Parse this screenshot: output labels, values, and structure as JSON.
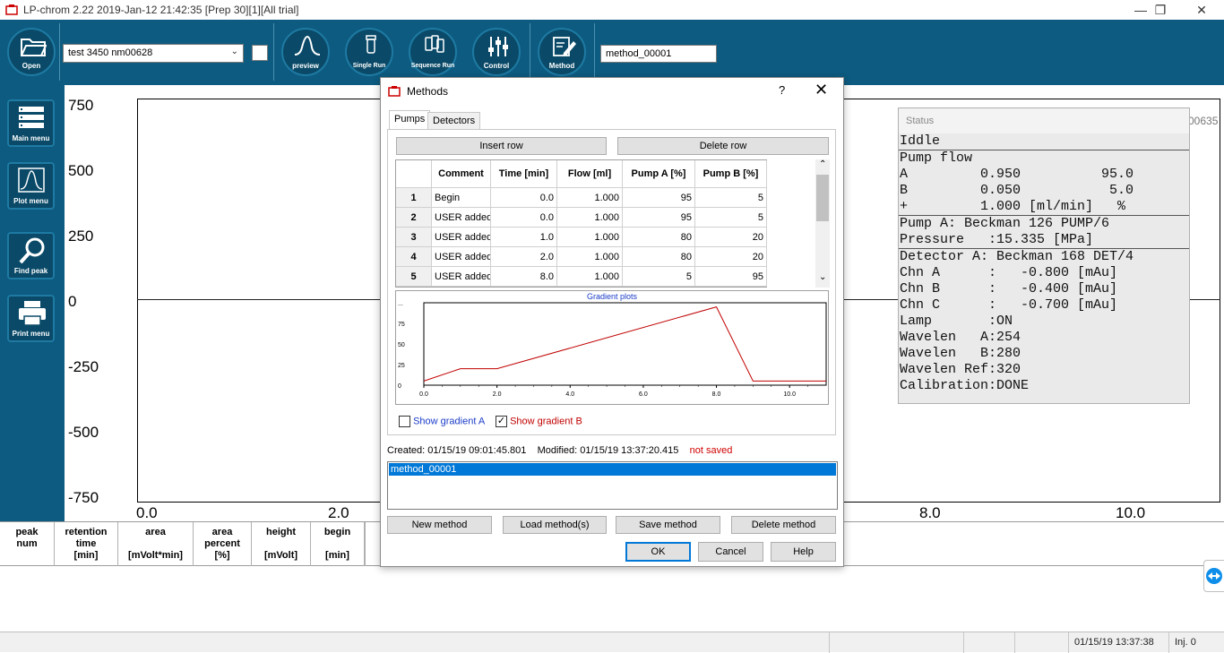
{
  "window": {
    "title": "LP-chrom 2.22 2019-Jan-12 21:42:35 [Prep 30][1][All trial]",
    "minimize": "—",
    "restore": "❐",
    "close": "✕"
  },
  "toolbar": {
    "open_label": "Open",
    "selected_sample": "test 3450 nm00628",
    "preview_label": "preview",
    "single_run_label": "Single Run",
    "sequence_run_label": "Sequence Run",
    "control_label": "Control",
    "method_label": "Method",
    "method_name": "method_00001"
  },
  "sidebar": {
    "items": [
      {
        "label": "Main menu",
        "icon": "list-icon"
      },
      {
        "label": "Plot menu",
        "icon": "peak-icon"
      },
      {
        "label": "Find peak",
        "icon": "magnifier-icon"
      },
      {
        "label": "Print menu",
        "icon": "printer-icon"
      }
    ]
  },
  "plot": {
    "y_ticks": [
      "750",
      "500",
      "250",
      "0",
      "-250",
      "-500",
      "-750"
    ],
    "x_ticks": [
      "0.0",
      "2.0",
      "8.0",
      "10.0"
    ],
    "corner_label": "00635"
  },
  "status_panel": {
    "header": "Status",
    "lines": [
      {
        "text": "Iddle",
        "sep": false
      },
      {
        "text": "Pump flow",
        "sep": true
      },
      {
        "text": "A         0.950          95.0",
        "sep": false
      },
      {
        "text": "B         0.050           5.0",
        "sep": false
      },
      {
        "text": "+         1.000 [ml/min]   %",
        "sep": false
      },
      {
        "text": "Pump A: Beckman 126 PUMP/6",
        "sep": true
      },
      {
        "text": "Pressure   :15.335 [MPa]",
        "sep": false
      },
      {
        "text": "Detector A: Beckman 168 DET/4",
        "sep": true
      },
      {
        "text": "Chn A      :   -0.800 [mAu]",
        "sep": false
      },
      {
        "text": "Chn B      :   -0.400 [mAu]",
        "sep": false
      },
      {
        "text": "Chn C      :   -0.700 [mAu]",
        "sep": false
      },
      {
        "text": "Lamp       :ON",
        "sep": false
      },
      {
        "text": "Wavelen   A:254",
        "sep": false
      },
      {
        "text": "Wavelen   B:280",
        "sep": false
      },
      {
        "text": "Wavelen Ref:320",
        "sep": false
      },
      {
        "text": "Calibration:DONE",
        "sep": false
      }
    ]
  },
  "peak_table": {
    "headers": [
      {
        "line1": "peak",
        "line2": "num",
        "line3": ""
      },
      {
        "line1": "retention",
        "line2": "time",
        "line3": "[min]"
      },
      {
        "line1": "area",
        "line2": "",
        "line3": "[mVolt*min]"
      },
      {
        "line1": "area",
        "line2": "percent",
        "line3": "[%]"
      },
      {
        "line1": "height",
        "line2": "",
        "line3": "[mVolt]"
      },
      {
        "line1": "begin",
        "line2": "",
        "line3": "[min]"
      }
    ]
  },
  "statusbar": {
    "datetime": "01/15/19 13:37:38",
    "injections": "Inj. 0"
  },
  "dialog": {
    "title": "Methods",
    "help_glyph": "?",
    "close_glyph": "✕",
    "tabs": [
      "Pumps",
      "Detectors"
    ],
    "insert_row": "Insert row",
    "delete_row": "Delete row",
    "table_headers": [
      "Comment",
      "Time [min]",
      "Flow [ml]",
      "Pump A [%]",
      "Pump B [%]"
    ],
    "rows": [
      {
        "n": "1",
        "comment": "Begin",
        "time": "0.0",
        "flow": "1.000",
        "a": "95",
        "b": "5"
      },
      {
        "n": "2",
        "comment": "USER added",
        "time": "0.0",
        "flow": "1.000",
        "a": "95",
        "b": "5"
      },
      {
        "n": "3",
        "comment": "USER added",
        "time": "1.0",
        "flow": "1.000",
        "a": "80",
        "b": "20"
      },
      {
        "n": "4",
        "comment": "USER added",
        "time": "2.0",
        "flow": "1.000",
        "a": "80",
        "b": "20"
      },
      {
        "n": "5",
        "comment": "USER added",
        "time": "8.0",
        "flow": "1.000",
        "a": "5",
        "b": "95"
      }
    ],
    "plot_title": "Gradient plots",
    "show_gradient_a": "Show gradient A",
    "show_gradient_b": "Show gradient B",
    "show_a_checked": false,
    "show_b_checked": true,
    "created_label": "Created: 01/15/19 09:01:45.801",
    "modified_label": "Modified: 01/15/19 13:37:20.415",
    "not_saved": "not saved",
    "methods": [
      "method_00001"
    ],
    "new_method": "New method",
    "load_method": "Load method(s)",
    "save_method": "Save method",
    "delete_method": "Delete method",
    "ok": "OK",
    "cancel": "Cancel",
    "help": "Help"
  },
  "chart_data": {
    "type": "line",
    "title": "Gradient plots",
    "xlabel": "",
    "ylabel": "",
    "xlim": [
      0,
      11
    ],
    "ylim": [
      0,
      100
    ],
    "x_ticks": [
      "0.0",
      "2.0",
      "4.0",
      "6.0",
      "8.0",
      "10.0"
    ],
    "y_ticks": [
      "0",
      "25",
      "50",
      "75",
      "..."
    ],
    "series": [
      {
        "name": "Show gradient B",
        "color": "#c00000",
        "x": [
          0,
          1,
          2,
          8,
          9,
          11
        ],
        "y": [
          5,
          20,
          20,
          95,
          5,
          5
        ]
      }
    ]
  }
}
